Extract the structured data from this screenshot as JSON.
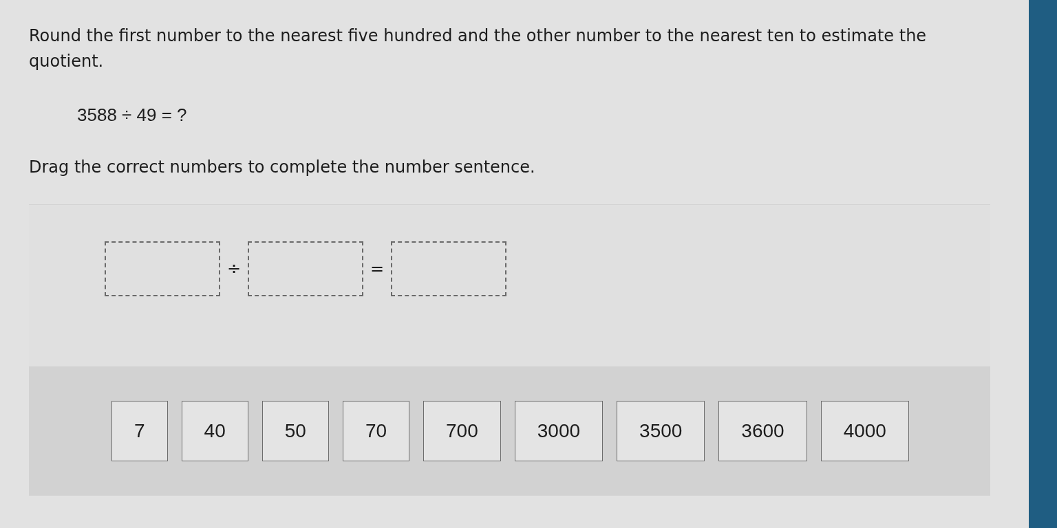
{
  "question": "Round the first number to the nearest five hundred and the other number to the nearest ten to estimate the quotient.",
  "equation": "3588 ÷ 49 = ?",
  "instruction": "Drag the correct numbers to complete the number sentence.",
  "sentence": [
    {
      "kind": "slot"
    },
    {
      "kind": "operator",
      "text": "÷"
    },
    {
      "kind": "slot"
    },
    {
      "kind": "operator",
      "text": "="
    },
    {
      "kind": "slot"
    }
  ],
  "tiles": [
    "7",
    "40",
    "50",
    "70",
    "700",
    "3000",
    "3500",
    "3600",
    "4000"
  ]
}
